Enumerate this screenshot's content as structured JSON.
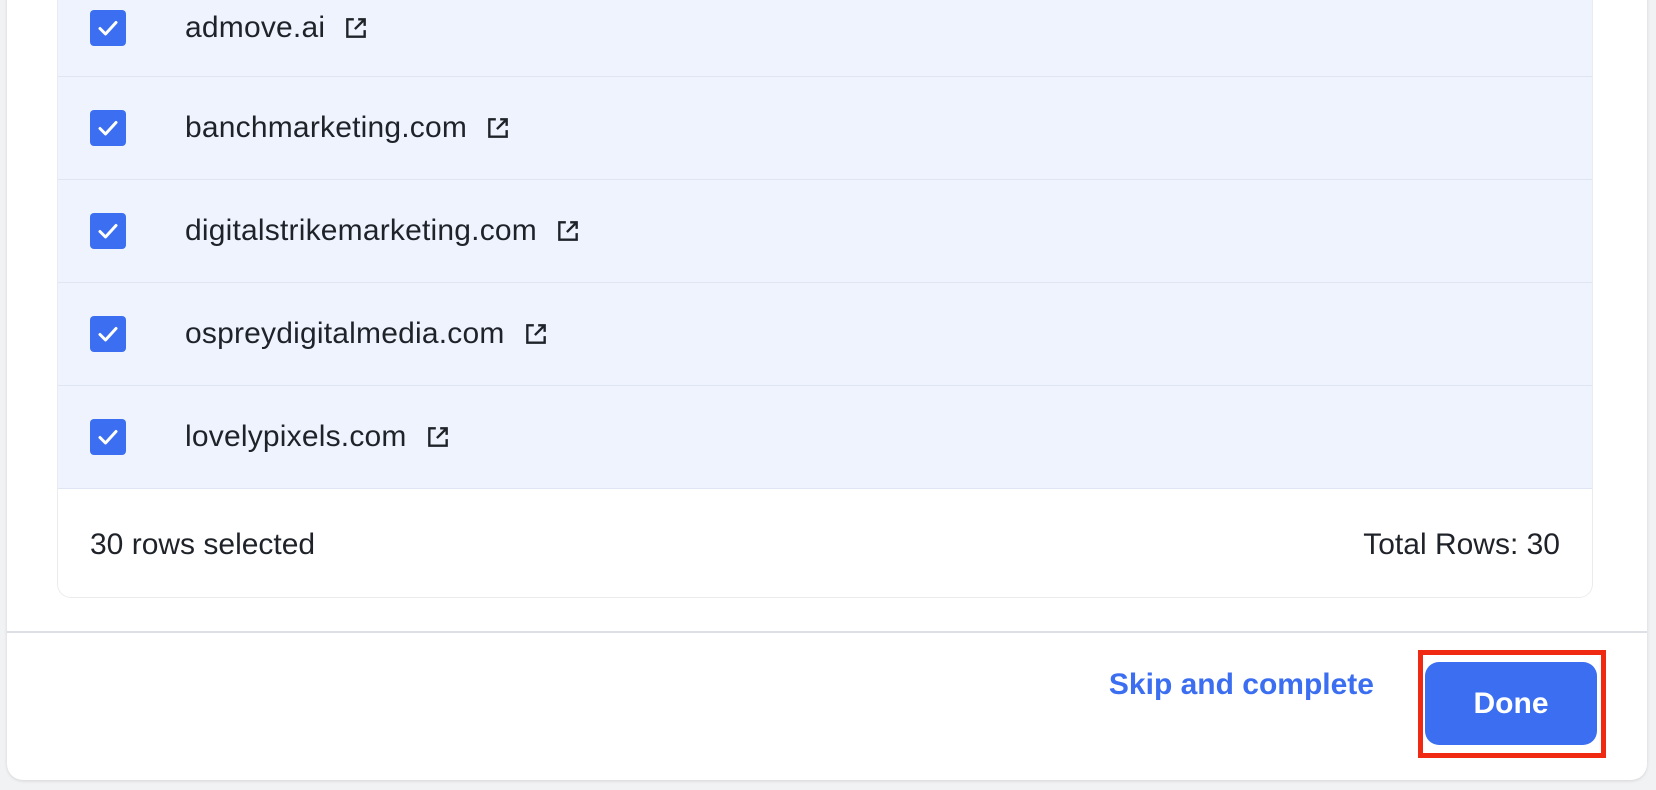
{
  "table": {
    "rows": [
      {
        "domain": "admove.ai",
        "checked": true
      },
      {
        "domain": "banchmarketing.com",
        "checked": true
      },
      {
        "domain": "digitalstrikemarketing.com",
        "checked": true
      },
      {
        "domain": "ospreydigitalmedia.com",
        "checked": true
      },
      {
        "domain": "lovelypixels.com",
        "checked": true
      }
    ],
    "selected_label": "30 rows selected",
    "total_label": "Total Rows: 30"
  },
  "actions": {
    "skip_label": "Skip and complete",
    "done_label": "Done"
  },
  "colors": {
    "accent": "#3b6ef0",
    "row_selected_bg": "#eef3fe",
    "highlight": "#f02a12"
  }
}
